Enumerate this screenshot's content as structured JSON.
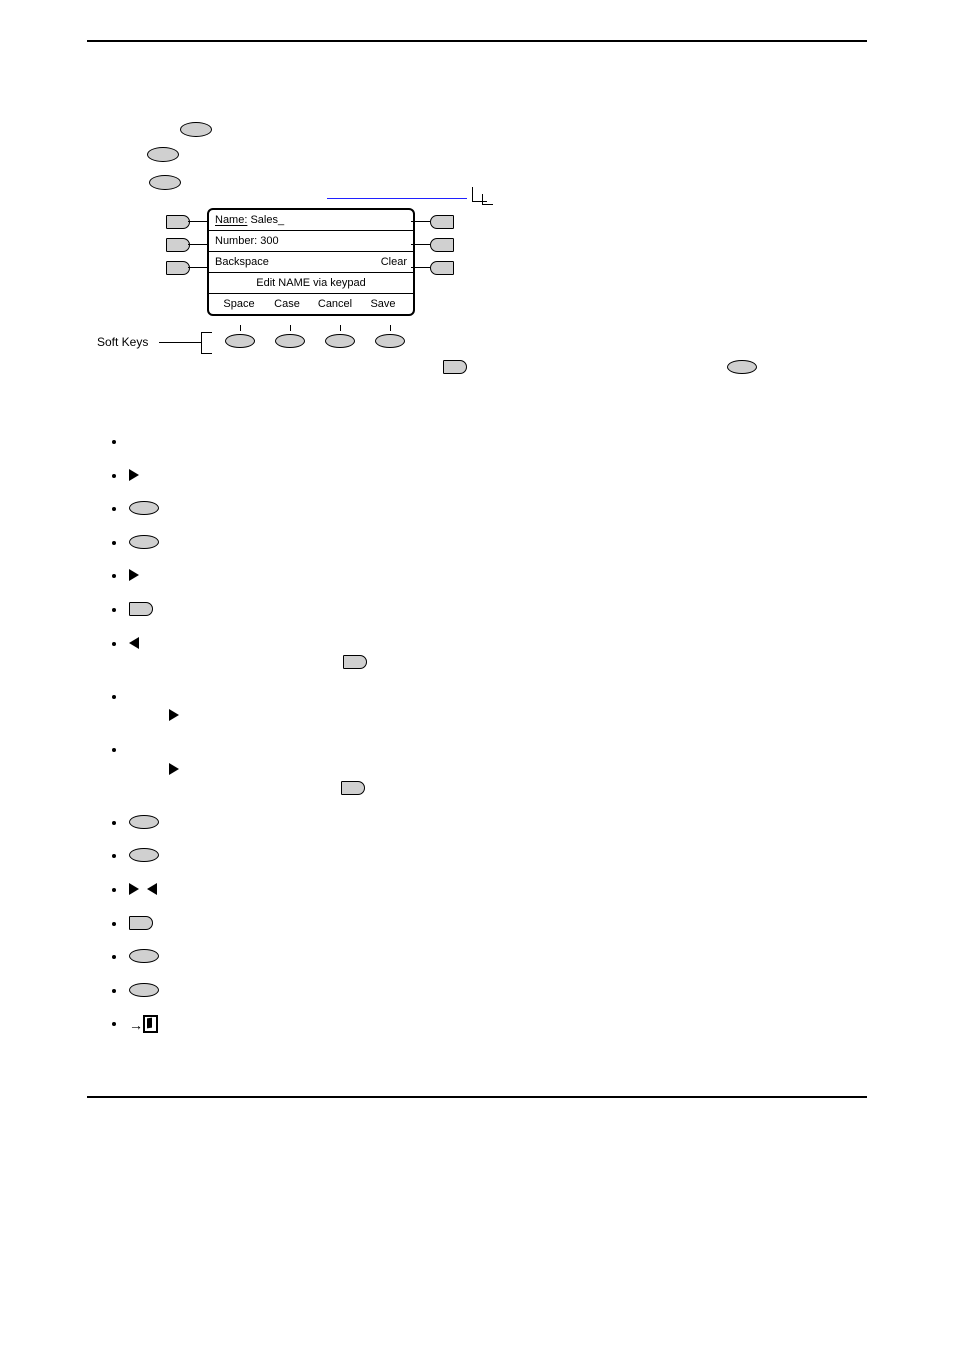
{
  "figure": {
    "softkeys_label": "Soft Keys",
    "lcd": {
      "name_label": "Name:",
      "name_value": "Sales_",
      "number_label": "Number:",
      "number_value": "300",
      "backspace": "Backspace",
      "clear": "Clear",
      "prompt": "Edit NAME via keypad",
      "sk": [
        "Space",
        "Case",
        "Cancel",
        "Save"
      ]
    }
  },
  "list": {
    "i0_a": "",
    "i1_a": "",
    "i1_b": "",
    "i2_a": "",
    "i2_b": "",
    "i3_a": "",
    "i3_b": "",
    "i4_a": "",
    "i4_b": "",
    "i5_a": "",
    "i5_b": "",
    "i6_a": "",
    "i6_b": "",
    "i6_c": "",
    "i7_a": "",
    "i7_b": "",
    "i8_a": "",
    "i8_b": "",
    "i8_c": "",
    "i9_a": "",
    "i9_b": "",
    "i10_a": "",
    "i10_b": "",
    "i11_a": "",
    "i11_b": "",
    "i11_c": "",
    "i12_a": "",
    "i12_b": "",
    "i13_a": "",
    "i13_b": "",
    "i14_a": "",
    "i14_b": "",
    "i15_a": "",
    "i15_b": ""
  }
}
